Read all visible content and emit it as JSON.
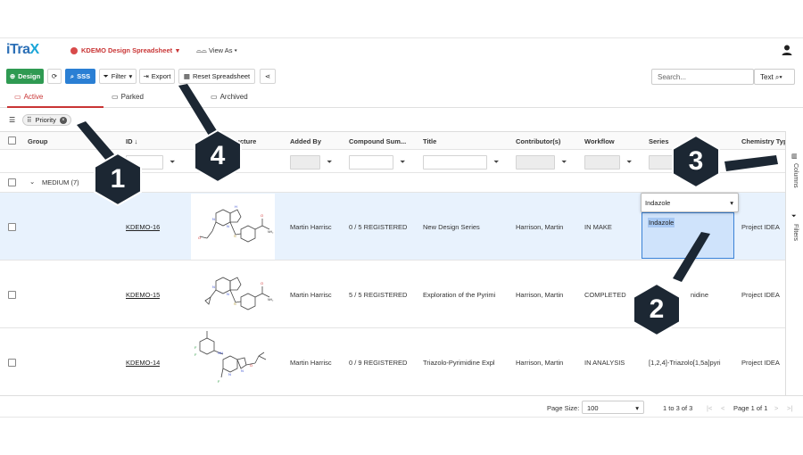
{
  "app": {
    "logo_main": "iTra",
    "logo_accent": "X",
    "project": "KDEMO Design Spreadsheet",
    "view_as": "View As"
  },
  "toolbar": {
    "design": "Design",
    "sss": "SSS",
    "filter": "Filter",
    "export": "Export",
    "reset": "Reset Spreadsheet",
    "search_placeholder": "Search...",
    "search_mode": "Text"
  },
  "tabs": [
    {
      "label": "Active"
    },
    {
      "label": "Parked"
    },
    {
      "label": "Archived"
    }
  ],
  "group_chip": "Priority",
  "columns": [
    "Group",
    "ID",
    "Structure",
    "Added By",
    "Compound Sum...",
    "Title",
    "Contributor(s)",
    "Workflow",
    "Series",
    "Chemistry Type"
  ],
  "group_row": "MEDIUM (7)",
  "rows": [
    {
      "id": "KDEMO-16",
      "added_by": "Martin Harrisc",
      "compound_summary": "0 / 5 REGISTERED",
      "title": "New Design Series",
      "contributors": "Harrison, Martin",
      "workflow": "IN MAKE",
      "series": "Indazole",
      "chemistry_type": "Project IDEA"
    },
    {
      "id": "KDEMO-15",
      "added_by": "Martin Harrisc",
      "compound_summary": "5 / 5 REGISTERED",
      "title": "Exploration of the Pyrimi",
      "contributors": "Harrison, Martin",
      "workflow": "COMPLETED",
      "series": "nidine",
      "chemistry_type": "Project IDEA"
    },
    {
      "id": "KDEMO-14",
      "added_by": "Martin Harrisc",
      "compound_summary": "0 / 9 REGISTERED",
      "title": "Triazolo-Pyrimidine Expl",
      "contributors": "Harrison, Martin",
      "workflow": "IN ANALYSIS",
      "series": "[1,2,4]-Triazolo[1,5a]pyri",
      "chemistry_type": "Project IDEA"
    }
  ],
  "series_dropdown_value": "Indazole",
  "sidebar": {
    "columns": "Columns",
    "filters": "Filters"
  },
  "footer": {
    "page_size_label": "Page Size:",
    "page_size": "100",
    "range": "1 to 3 of 3",
    "page": "Page 1 of 1"
  },
  "callouts": [
    "1",
    "2",
    "3",
    "4"
  ],
  "colors": {
    "accent_red": "#c93535",
    "green": "#2f9a52",
    "blue": "#2a7fd4",
    "callout": "#1c2733",
    "selected_row": "#e8f2fd"
  }
}
